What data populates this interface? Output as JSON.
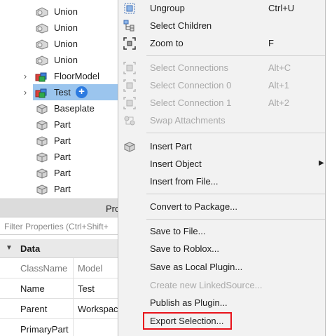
{
  "explorer": {
    "items": [
      {
        "label": "Union",
        "icon": "union-icon",
        "expandable": false,
        "selected": false
      },
      {
        "label": "Union",
        "icon": "union-icon",
        "expandable": false,
        "selected": false
      },
      {
        "label": "Union",
        "icon": "union-icon",
        "expandable": false,
        "selected": false
      },
      {
        "label": "Union",
        "icon": "union-icon",
        "expandable": false,
        "selected": false
      },
      {
        "label": "FloorModel",
        "icon": "model-icon",
        "expandable": true,
        "selected": false
      },
      {
        "label": "Test",
        "icon": "model-icon",
        "expandable": true,
        "selected": true
      },
      {
        "label": "Baseplate",
        "icon": "part-icon",
        "expandable": false,
        "selected": false
      },
      {
        "label": "Part",
        "icon": "part-icon",
        "expandable": false,
        "selected": false
      },
      {
        "label": "Part",
        "icon": "part-icon",
        "expandable": false,
        "selected": false
      },
      {
        "label": "Part",
        "icon": "part-icon",
        "expandable": false,
        "selected": false
      },
      {
        "label": "Part",
        "icon": "part-icon",
        "expandable": false,
        "selected": false
      },
      {
        "label": "Part",
        "icon": "part-icon",
        "expandable": false,
        "selected": false
      }
    ],
    "add_badge": "+"
  },
  "properties": {
    "header_title": "Pro",
    "filter_placeholder": "Filter Properties (Ctrl+Shift+",
    "section_label": "Data",
    "rows": [
      {
        "name": "ClassName",
        "value": "Model"
      },
      {
        "name": "Name",
        "value": "Test"
      },
      {
        "name": "Parent",
        "value": "Workspac"
      },
      {
        "name": "PrimaryPart",
        "value": ""
      }
    ]
  },
  "context_menu": {
    "items": [
      {
        "label": "Ungroup",
        "shortcut": "Ctrl+U",
        "icon": "ungroup-icon",
        "enabled": true
      },
      {
        "label": "Select Children",
        "shortcut": "",
        "icon": "select-children-icon",
        "enabled": true
      },
      {
        "label": "Zoom to",
        "shortcut": "F",
        "icon": "zoom-to-icon",
        "enabled": true
      },
      {
        "label": "Select Connections",
        "shortcut": "Alt+C",
        "icon": "select-connections-icon",
        "enabled": false
      },
      {
        "label": "Select Connection 0",
        "shortcut": "Alt+1",
        "icon": "select-connection-icon",
        "enabled": false
      },
      {
        "label": "Select Connection 1",
        "shortcut": "Alt+2",
        "icon": "select-connection-icon",
        "enabled": false
      },
      {
        "label": "Swap Attachments",
        "shortcut": "",
        "icon": "swap-attachments-icon",
        "enabled": false
      },
      {
        "label": "Insert Part",
        "shortcut": "",
        "icon": "part-icon",
        "enabled": true
      },
      {
        "label": "Insert Object",
        "shortcut": "",
        "icon": "",
        "enabled": true,
        "submenu": true
      },
      {
        "label": "Insert from File...",
        "shortcut": "",
        "icon": "",
        "enabled": true
      },
      {
        "label": "Convert to Package...",
        "shortcut": "",
        "icon": "",
        "enabled": true
      },
      {
        "label": "Save to File...",
        "shortcut": "",
        "icon": "",
        "enabled": true
      },
      {
        "label": "Save to Roblox...",
        "shortcut": "",
        "icon": "",
        "enabled": true
      },
      {
        "label": "Save as Local Plugin...",
        "shortcut": "",
        "icon": "",
        "enabled": true
      },
      {
        "label": "Create new LinkedSource...",
        "shortcut": "",
        "icon": "",
        "enabled": false
      },
      {
        "label": "Publish as Plugin...",
        "shortcut": "",
        "icon": "",
        "enabled": true
      },
      {
        "label": "Export Selection...",
        "shortcut": "",
        "icon": "",
        "enabled": true,
        "highlighted": true
      }
    ]
  },
  "colors": {
    "selection": "#9bc5ee",
    "highlight_box": "#e8131b",
    "disabled_text": "#a9a9a9",
    "add_badge": "#2d7be0"
  }
}
